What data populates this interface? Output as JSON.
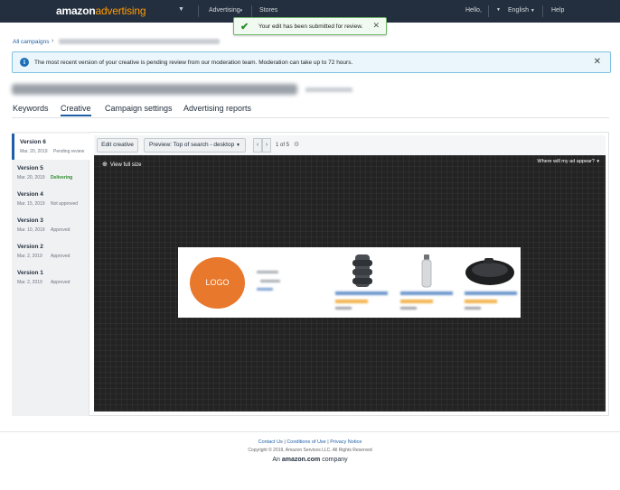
{
  "nav": {
    "brand_part1": "amazon",
    "brand_part2": "advertising",
    "advertising": "Advertising",
    "stores": "Stores",
    "hello": "Hello,",
    "language": "English",
    "help": "Help"
  },
  "toast": {
    "message": "Your edit has been submitted for review."
  },
  "breadcrumb": {
    "root": "All campaigns"
  },
  "banner": {
    "text": "The most recent version of your creative is pending review from our moderation team. Moderation can take up to 72 hours."
  },
  "tabs": [
    {
      "label": "Keywords"
    },
    {
      "label": "Creative"
    },
    {
      "label": "Campaign settings"
    },
    {
      "label": "Advertising reports"
    }
  ],
  "versions": [
    {
      "title": "Version 6",
      "date": "Mar. 20, 2019",
      "status": "Pending review"
    },
    {
      "title": "Version 5",
      "date": "Mar. 20, 2019",
      "status": "Delivering"
    },
    {
      "title": "Version 4",
      "date": "Mar. 15, 2019",
      "status": "Not approved"
    },
    {
      "title": "Version 3",
      "date": "Mar. 10, 2019",
      "status": "Approved"
    },
    {
      "title": "Version 2",
      "date": "Mar. 2, 2019",
      "status": "Approved"
    },
    {
      "title": "Version 1",
      "date": "Mar. 2, 2019",
      "status": "Approved"
    }
  ],
  "toolbar": {
    "edit_label": "Edit creative",
    "preview_label": "Preview: Top of search - desktop",
    "count": "1 of 5"
  },
  "canvas": {
    "view_full": "View full size",
    "where_label": "Where will my ad appear?"
  },
  "ad": {
    "logo": "LOGO"
  },
  "footer": {
    "contact": "Contact Us",
    "conditions": "Conditions of Use",
    "privacy": "Privacy Notice",
    "copyright": "Copyright © 2019, Amazon Services LLC. All Rights Reserved",
    "company_prefix": "An",
    "company_brand": "amazon.com",
    "company_suffix": "company"
  },
  "colors": {
    "nav_bg": "#232f3e",
    "brand_accent": "#ff9900",
    "link_blue": "#1f5fa8",
    "logo_orange": "#e8782c",
    "success_green": "#2e8b2e"
  }
}
